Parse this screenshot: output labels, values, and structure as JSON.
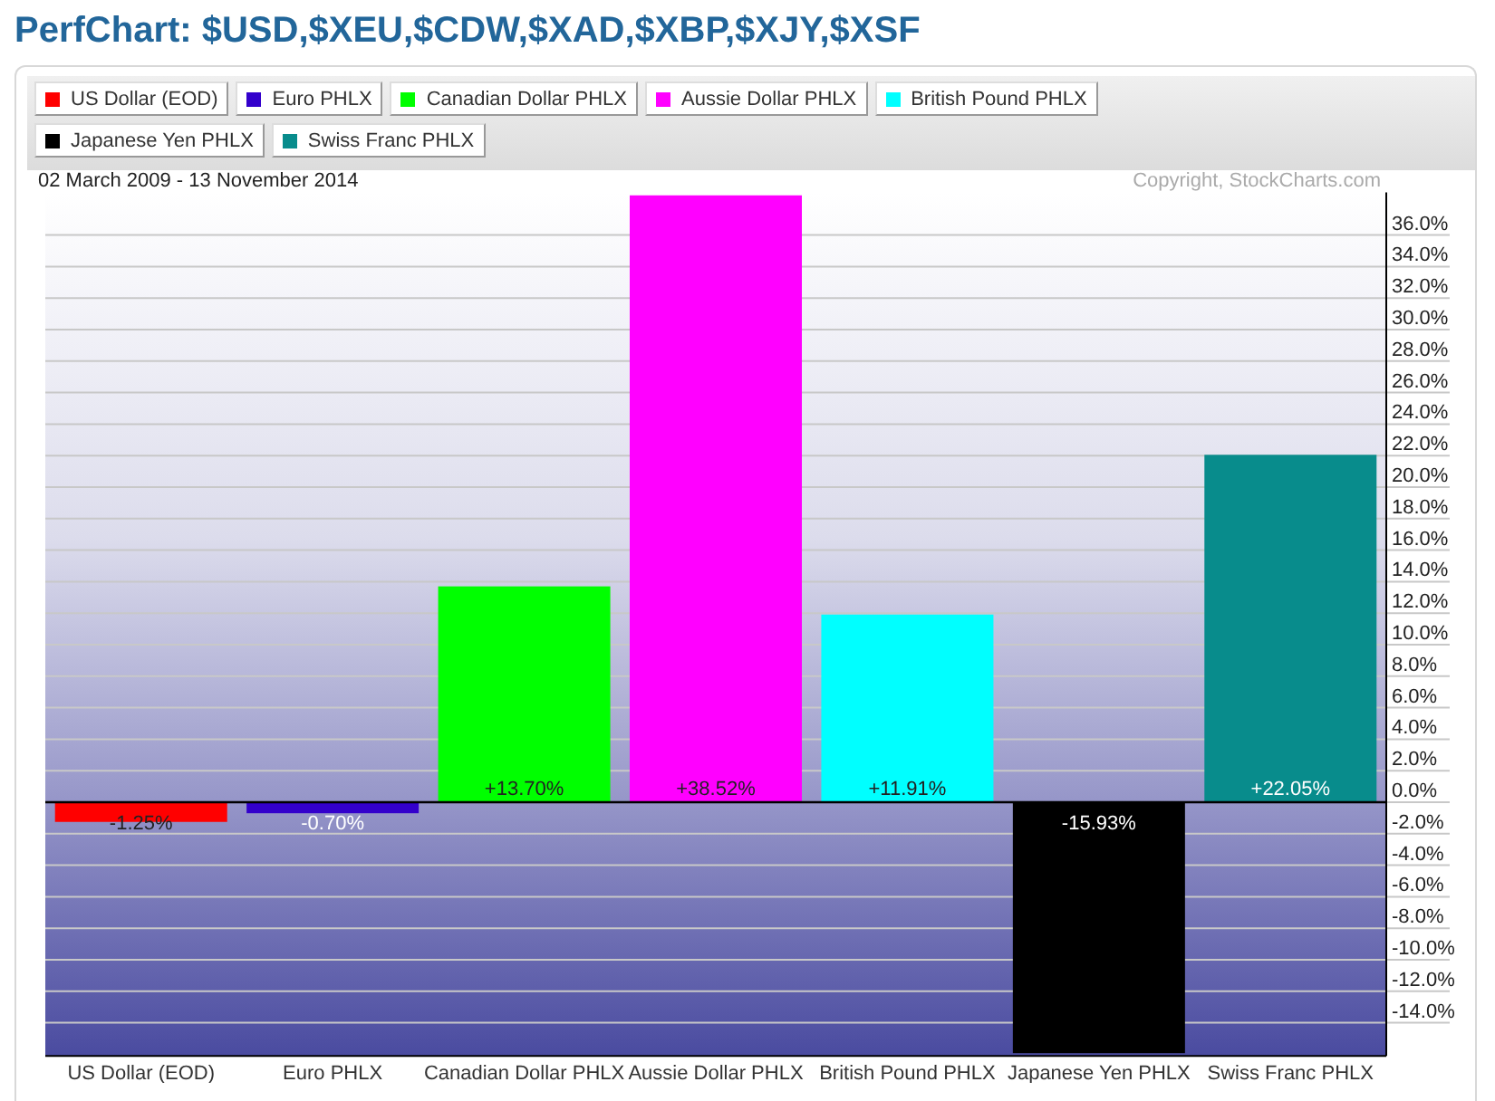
{
  "title": "PerfChart: $USD,$XEU,$CDW,$XAD,$XBP,$XJY,$XSF",
  "legend": [
    {
      "label": "US Dollar (EOD)",
      "color": "#ff0000"
    },
    {
      "label": "Euro PHLX",
      "color": "#3300cc"
    },
    {
      "label": "Canadian Dollar PHLX",
      "color": "#00ff00"
    },
    {
      "label": "Aussie Dollar PHLX",
      "color": "#ff00ff"
    },
    {
      "label": "British Pound PHLX",
      "color": "#00ffff"
    },
    {
      "label": "Japanese Yen PHLX",
      "color": "#000000"
    },
    {
      "label": "Swiss Franc PHLX",
      "color": "#088c8c"
    }
  ],
  "date_range": "02 March 2009 - 13 November 2014",
  "copyright": "Copyright, StockCharts.com",
  "chart_data": {
    "type": "bar",
    "grid": true,
    "categories": [
      "US Dollar (EOD)",
      "Euro PHLX",
      "Canadian Dollar PHLX",
      "Aussie Dollar PHLX",
      "British Pound PHLX",
      "Japanese Yen PHLX",
      "Swiss Franc PHLX"
    ],
    "values": [
      -1.25,
      -0.7,
      13.7,
      38.52,
      11.91,
      -15.93,
      22.05
    ],
    "value_labels": [
      "-1.25%",
      "-0.70%",
      "+13.70%",
      "+38.52%",
      "+11.91%",
      "-15.93%",
      "+22.05%"
    ],
    "ylim": [
      -16.1,
      38.7
    ],
    "yticks": [
      {
        "value": 36,
        "label": "36.0%"
      },
      {
        "value": 34,
        "label": "34.0%"
      },
      {
        "value": 32,
        "label": "32.0%"
      },
      {
        "value": 30,
        "label": "30.0%"
      },
      {
        "value": 28,
        "label": "28.0%"
      },
      {
        "value": 26,
        "label": "26.0%"
      },
      {
        "value": 24,
        "label": "24.0%"
      },
      {
        "value": 22,
        "label": "22.0%"
      },
      {
        "value": 20,
        "label": "20.0%"
      },
      {
        "value": 18,
        "label": "18.0%"
      },
      {
        "value": 16,
        "label": "16.0%"
      },
      {
        "value": 14,
        "label": "14.0%"
      },
      {
        "value": 12,
        "label": "12.0%"
      },
      {
        "value": 10,
        "label": "10.0%"
      },
      {
        "value": 8,
        "label": "8.0%"
      },
      {
        "value": 6,
        "label": "6.0%"
      },
      {
        "value": 4,
        "label": "4.0%"
      },
      {
        "value": 2,
        "label": "2.0%"
      },
      {
        "value": 0,
        "label": "0.0%"
      },
      {
        "value": -2,
        "label": "-2.0%"
      },
      {
        "value": -4,
        "label": "-4.0%"
      },
      {
        "value": -6,
        "label": "-6.0%"
      },
      {
        "value": -8,
        "label": "-8.0%"
      },
      {
        "value": -10,
        "label": "-10.0%"
      },
      {
        "value": -12,
        "label": "-12.0%"
      },
      {
        "value": -14,
        "label": "-14.0%"
      }
    ]
  }
}
